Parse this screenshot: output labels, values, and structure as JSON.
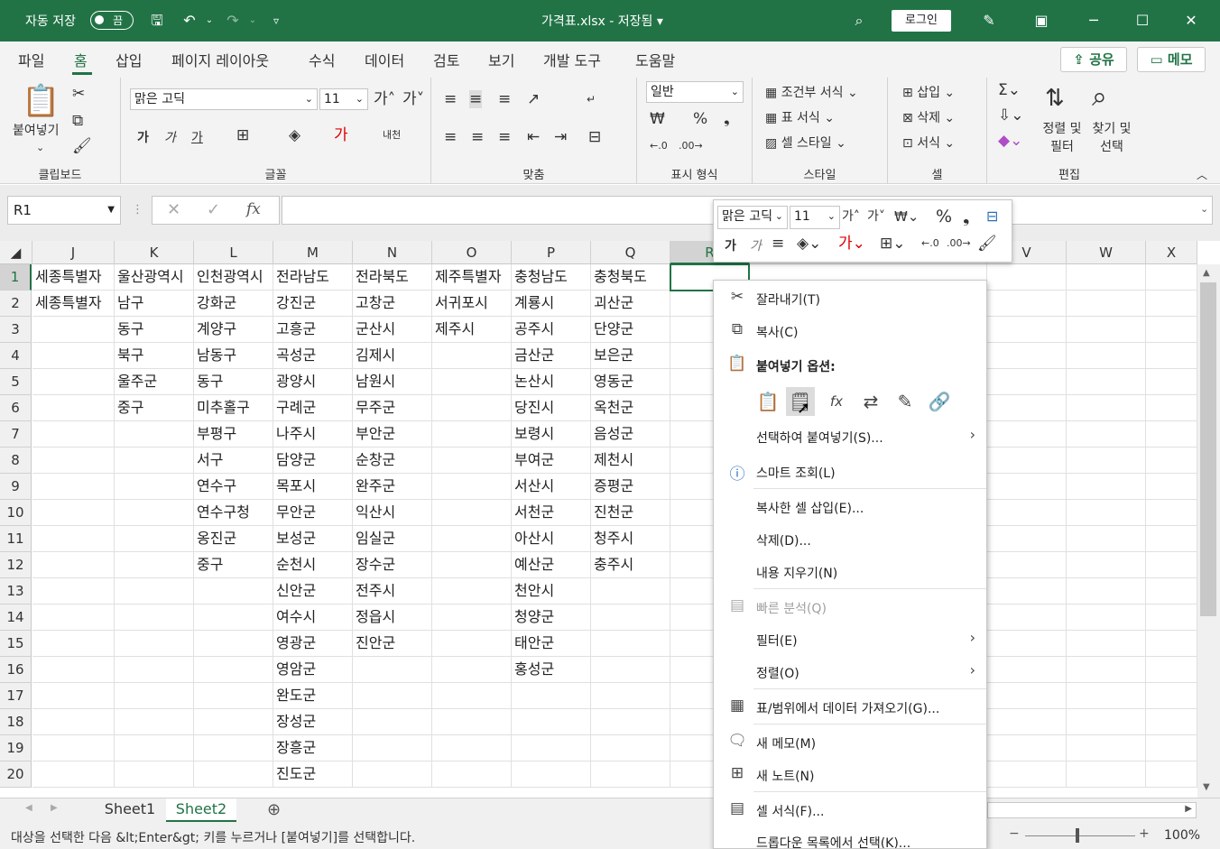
{
  "titlebar": {
    "autosave_label": "자동 저장",
    "autosave_state": "끔",
    "title": "가격표.xlsx  -  저장됨  ▾",
    "login": "로그인"
  },
  "menu": {
    "tabs": [
      "파일",
      "홈",
      "삽입",
      "페이지 레이아웃",
      "수식",
      "데이터",
      "검토",
      "보기",
      "개발 도구",
      "도움말"
    ],
    "share": "공유",
    "memo": "메모"
  },
  "ribbon": {
    "clipboard": {
      "paste": "붙여넣기",
      "label": "클립보드"
    },
    "font": {
      "name": "맑은 고딕",
      "size": "11",
      "bold": "가",
      "italic": "가",
      "underline": "가",
      "label": "글꼴"
    },
    "align": {
      "label": "맞춤"
    },
    "number": {
      "format": "일반",
      "label": "표시 형식"
    },
    "styles": {
      "cond": "조건부 서식",
      "table": "표 서식",
      "cell": "셀 스타일",
      "label": "스타일"
    },
    "cells": {
      "insert": "삽입",
      "delete": "삭제",
      "format": "서식",
      "label": "셀"
    },
    "edit": {
      "sort": "정렬 및 필터",
      "find": "찾기 및 선택",
      "label": "편집"
    }
  },
  "formula": {
    "namebox": "R1",
    "fx": "fx",
    "value": ""
  },
  "columns": [
    "J",
    "K",
    "L",
    "M",
    "N",
    "O",
    "P",
    "Q",
    "R",
    "",
    "V",
    "W",
    "X"
  ],
  "rows": [
    "1",
    "2",
    "3",
    "4",
    "5",
    "6",
    "7",
    "8",
    "9",
    "10",
    "11",
    "12",
    "13",
    "14",
    "15",
    "16",
    "17",
    "18",
    "19",
    "20"
  ],
  "grid": [
    [
      "세종특별자",
      "울산광역시",
      "인천광역시",
      "전라남도",
      "전라북도",
      "제주특별자",
      "충청남도",
      "충청북도"
    ],
    [
      "세종특별자",
      "남구",
      "강화군",
      "강진군",
      "고창군",
      "서귀포시",
      "계룡시",
      "괴산군"
    ],
    [
      "",
      "동구",
      "계양구",
      "고흥군",
      "군산시",
      "제주시",
      "공주시",
      "단양군"
    ],
    [
      "",
      "북구",
      "남동구",
      "곡성군",
      "김제시",
      "",
      "금산군",
      "보은군"
    ],
    [
      "",
      "울주군",
      "동구",
      "광양시",
      "남원시",
      "",
      "논산시",
      "영동군"
    ],
    [
      "",
      "중구",
      "미추홀구",
      "구례군",
      "무주군",
      "",
      "당진시",
      "옥천군"
    ],
    [
      "",
      "",
      "부평구",
      "나주시",
      "부안군",
      "",
      "보령시",
      "음성군"
    ],
    [
      "",
      "",
      "서구",
      "담양군",
      "순창군",
      "",
      "부여군",
      "제천시"
    ],
    [
      "",
      "",
      "연수구",
      "목포시",
      "완주군",
      "",
      "서산시",
      "증평군"
    ],
    [
      "",
      "",
      "연수구청",
      "무안군",
      "익산시",
      "",
      "서천군",
      "진천군"
    ],
    [
      "",
      "",
      "옹진군",
      "보성군",
      "임실군",
      "",
      "아산시",
      "청주시"
    ],
    [
      "",
      "",
      "중구",
      "순천시",
      "장수군",
      "",
      "예산군",
      "충주시"
    ],
    [
      "",
      "",
      "",
      "신안군",
      "전주시",
      "",
      "천안시",
      ""
    ],
    [
      "",
      "",
      "",
      "여수시",
      "정읍시",
      "",
      "청양군",
      ""
    ],
    [
      "",
      "",
      "",
      "영광군",
      "진안군",
      "",
      "태안군",
      ""
    ],
    [
      "",
      "",
      "",
      "영암군",
      "",
      "",
      "홍성군",
      ""
    ],
    [
      "",
      "",
      "",
      "완도군",
      "",
      "",
      "",
      ""
    ],
    [
      "",
      "",
      "",
      "장성군",
      "",
      "",
      "",
      ""
    ],
    [
      "",
      "",
      "",
      "장흥군",
      "",
      "",
      "",
      ""
    ],
    [
      "",
      "",
      "",
      "진도군",
      "",
      "",
      "",
      ""
    ]
  ],
  "sheets": [
    "Sheet1",
    "Sheet2"
  ],
  "status": {
    "message": "대상을 선택한 다음 &lt;Enter&gt; 키를 누르거나 [붙여넣기]를 선택합니다.",
    "zoom": "100%"
  },
  "minitoolbar": {
    "font": "맑은 고딕",
    "size": "11",
    "bold": "가",
    "italic": "가"
  },
  "context_menu": {
    "cut": "잘라내기(T)",
    "copy": "복사(C)",
    "paste_options": "붙여넣기 옵션:",
    "paste_special": "선택하여 붙여넣기(S)...",
    "smart_lookup": "스마트 조회(L)",
    "insert_copied": "복사한 셀 삽입(E)...",
    "delete": "삭제(D)...",
    "clear": "내용 지우기(N)",
    "quick_analysis": "빠른 분석(Q)",
    "filter": "필터(E)",
    "sort": "정렬(O)",
    "get_data": "표/범위에서 데이터 가져오기(G)...",
    "new_memo": "새 메모(M)",
    "new_note": "새 노트(N)",
    "format_cells": "셀 서식(F)...",
    "pick_list": "드롭다운 목록에서 선택(K)..."
  }
}
